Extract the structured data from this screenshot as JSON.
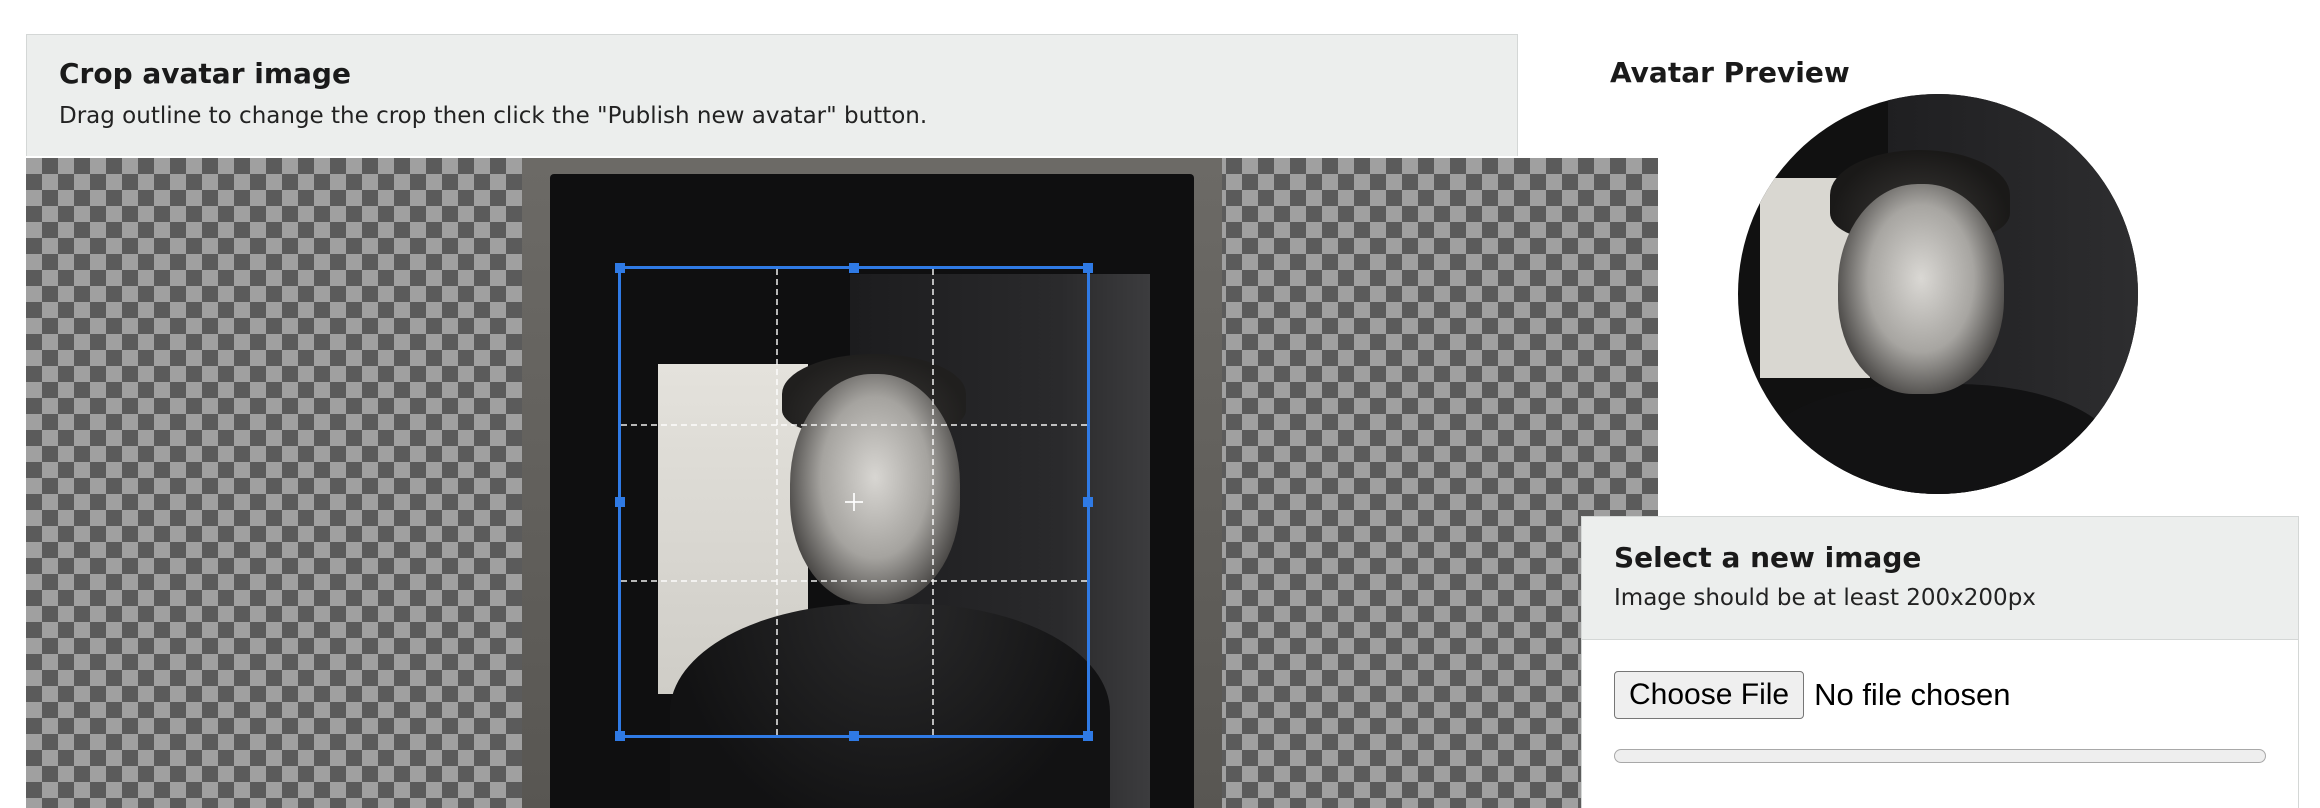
{
  "crop_panel": {
    "title": "Crop avatar image",
    "description": "Drag outline to change the crop then click the \"Publish new avatar\" button."
  },
  "preview": {
    "title": "Avatar Preview"
  },
  "select_panel": {
    "title": "Select a new image",
    "hint": "Image should be at least 200x200px",
    "choose_button_label": "Choose File",
    "file_status": "No file chosen",
    "upload_progress": 0
  },
  "colors": {
    "accent": "#2f7ae5",
    "panel_background": "#eceeed",
    "panel_border": "#d4d7d6"
  }
}
